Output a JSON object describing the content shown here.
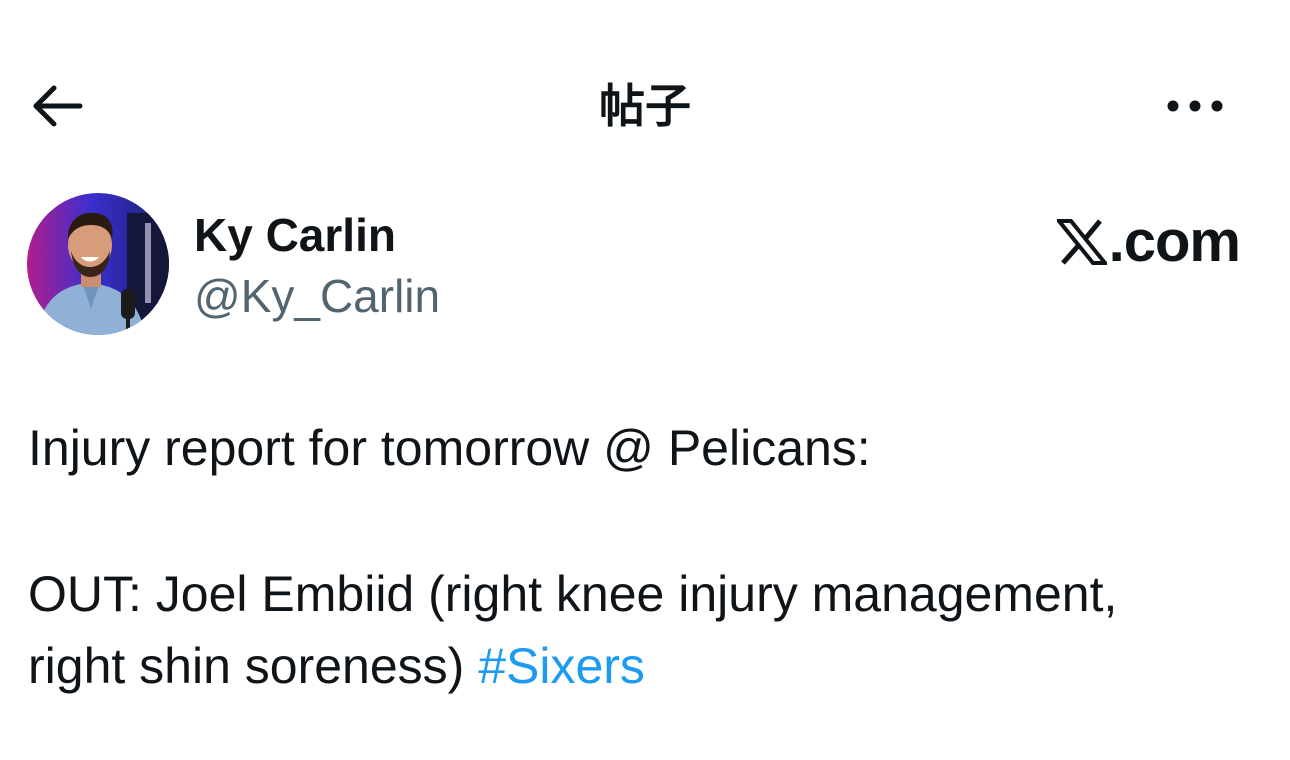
{
  "header": {
    "back_icon": "arrow-left-icon",
    "title": "帖子",
    "more_icon": "more-horizontal-icon"
  },
  "author": {
    "name": "Ky Carlin",
    "handle": "@Ky_Carlin",
    "avatar_icon": "profile-photo"
  },
  "brand": {
    "logo_icon": "x-logo-icon",
    "text": ".com"
  },
  "tweet": {
    "line1": "Injury report for tomorrow @ Pelicans:",
    "line2": "OUT: Joel Embiid (right knee injury management,",
    "line3_text": "right shin soreness) ",
    "hashtag": "#Sixers"
  },
  "colors": {
    "text": "#0f1419",
    "secondary": "#536471",
    "link": "#1d9bf0",
    "background": "#ffffff"
  }
}
